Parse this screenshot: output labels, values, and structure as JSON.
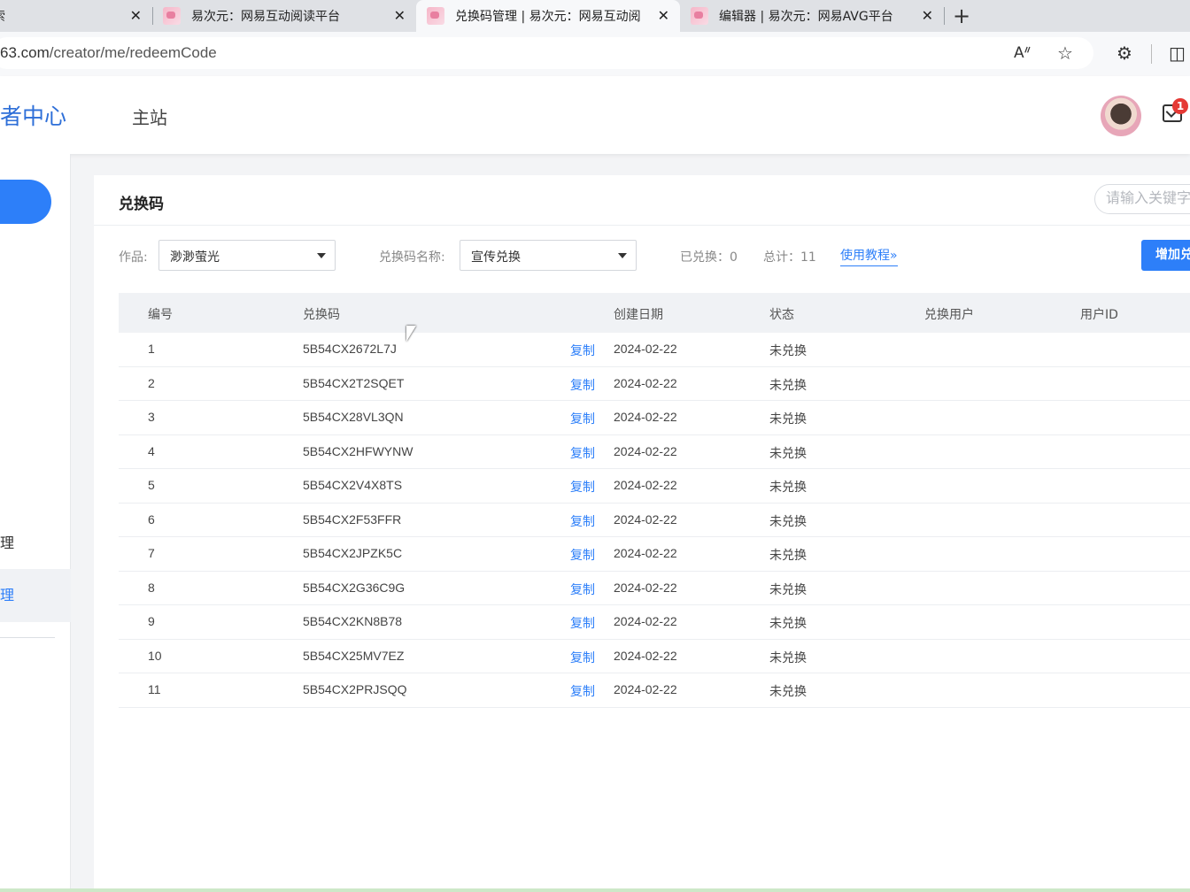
{
  "browser": {
    "tabs": [
      {
        "title": "索",
        "active": false
      },
      {
        "title": "易次元：网易互动阅读平台",
        "active": false
      },
      {
        "title": "兑换码管理 | 易次元：网易互动阅",
        "active": true
      },
      {
        "title": "编辑器 | 易次元：网易AVG平台",
        "active": false
      }
    ],
    "url_host_tail": "63.com",
    "url_path": "/creator/me/redeemCode"
  },
  "header": {
    "brand": "者中心",
    "nav_home": "主站",
    "unread_count": "1"
  },
  "sidebar": {
    "items": [
      {
        "label": "理",
        "active": false
      },
      {
        "label": "理",
        "active": true
      }
    ]
  },
  "main": {
    "title": "兑换码",
    "search_placeholder": "请输入关键字",
    "filters": {
      "work_label": "作品:",
      "work_value": "渺渺萤光",
      "code_name_label": "兑换码名称:",
      "code_name_value": "宣传兑换"
    },
    "stats": {
      "redeemed": "已兑换：0",
      "total": "总计：11"
    },
    "tutorial_link": "使用教程»",
    "add_button": "增加兑换码",
    "columns": [
      "编号",
      "兑换码",
      "创建日期",
      "状态",
      "兑换用户",
      "用户ID"
    ],
    "copy_label": "复制",
    "rows": [
      {
        "id": "1",
        "code": "5B54CX2672L7J",
        "date": "2024-02-22",
        "status": "未兑换"
      },
      {
        "id": "2",
        "code": "5B54CX2T2SQET",
        "date": "2024-02-22",
        "status": "未兑换"
      },
      {
        "id": "3",
        "code": "5B54CX28VL3QN",
        "date": "2024-02-22",
        "status": "未兑换"
      },
      {
        "id": "4",
        "code": "5B54CX2HFWYNW",
        "date": "2024-02-22",
        "status": "未兑换"
      },
      {
        "id": "5",
        "code": "5B54CX2V4X8TS",
        "date": "2024-02-22",
        "status": "未兑换"
      },
      {
        "id": "6",
        "code": "5B54CX2F53FFR",
        "date": "2024-02-22",
        "status": "未兑换"
      },
      {
        "id": "7",
        "code": "5B54CX2JPZK5C",
        "date": "2024-02-22",
        "status": "未兑换"
      },
      {
        "id": "8",
        "code": "5B54CX2G36C9G",
        "date": "2024-02-22",
        "status": "未兑换"
      },
      {
        "id": "9",
        "code": "5B54CX2KN8B78",
        "date": "2024-02-22",
        "status": "未兑换"
      },
      {
        "id": "10",
        "code": "5B54CX25MV7EZ",
        "date": "2024-02-22",
        "status": "未兑换"
      },
      {
        "id": "11",
        "code": "5B54CX2PRJSQQ",
        "date": "2024-02-22",
        "status": "未兑换"
      }
    ]
  }
}
